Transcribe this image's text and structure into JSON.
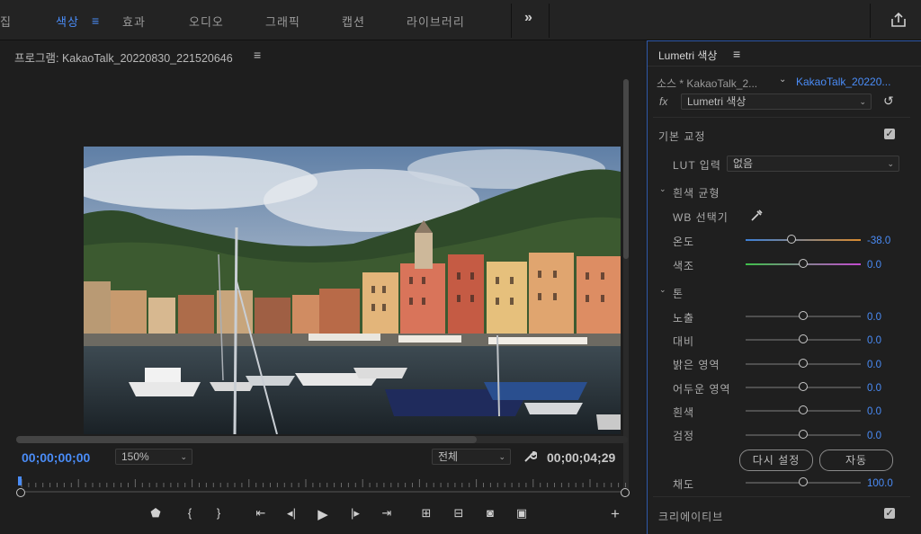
{
  "workspaces": {
    "tabs": [
      "집",
      "색상",
      "효과",
      "오디오",
      "그래픽",
      "캡션",
      "라이브러리"
    ],
    "overflow": "»"
  },
  "program": {
    "title": "프로그램: KakaoTalk_20220830_221520646",
    "menu_icon": "hamburger-icon",
    "timecode_current": "00;00;00;00",
    "zoom": "150%",
    "quality": "전체",
    "timecode_duration": "00;00;04;29"
  },
  "lumetri": {
    "title": "Lumetri 색상",
    "source_label": "소스 * KakaoTalk_2...",
    "clip_label": "KakaoTalk_20220...",
    "fx_label": "fx",
    "effect_name": "Lumetri 색상",
    "basic_correction": "기본 교정",
    "basic_correction_checked": true,
    "lut_label": "LUT 입력",
    "lut_value": "없음",
    "white_balance": "흰색 균형",
    "wb_picker": "WB 선택기",
    "temperature": {
      "label": "온도",
      "value": "-38.0",
      "level": 0.4
    },
    "tint": {
      "label": "색조",
      "value": "0.0",
      "level": 0.5
    },
    "tone": "톤",
    "exposure": {
      "label": "노출",
      "value": "0.0",
      "level": 0.5
    },
    "contrast": {
      "label": "대비",
      "value": "0.0",
      "level": 0.5
    },
    "highlights": {
      "label": "밝은 영역",
      "value": "0.0",
      "level": 0.5
    },
    "shadows": {
      "label": "어두운 영역",
      "value": "0.0",
      "level": 0.5
    },
    "whites": {
      "label": "흰색",
      "value": "0.0",
      "level": 0.5
    },
    "blacks": {
      "label": "검정",
      "value": "0.0",
      "level": 0.5
    },
    "reset_button": "다시 설정",
    "auto_button": "자동",
    "saturation": {
      "label": "채도",
      "value": "100.0",
      "level": 0.5
    },
    "creative": "크리에이티브",
    "creative_checked": true
  },
  "colors": {
    "accent_blue": "#4a8cf7",
    "panel_border": "#2e58a8"
  }
}
